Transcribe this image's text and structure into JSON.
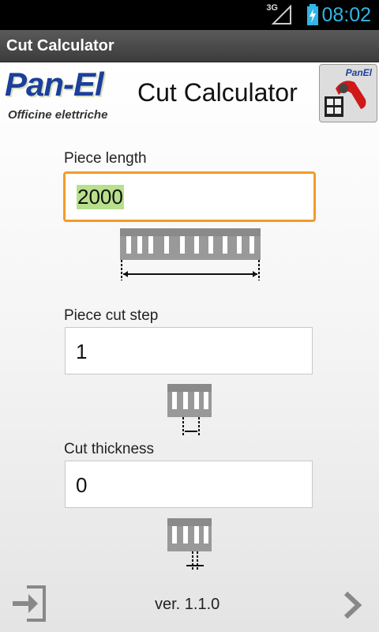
{
  "status_bar": {
    "network": "3G",
    "time": "08:02"
  },
  "app_title": "Cut Calculator",
  "header": {
    "logo_main": "Pan-El",
    "logo_sub": "Officine elettriche",
    "title": "Cut Calculator",
    "app_icon_text": "PanEl"
  },
  "form": {
    "piece_length": {
      "label": "Piece length",
      "value": "2000"
    },
    "piece_cut_step": {
      "label": "Piece cut step",
      "value": "1"
    },
    "cut_thickness": {
      "label": "Cut thickness",
      "value": "0"
    }
  },
  "footer": {
    "version": "ver. 1.1.0",
    "exit_icon": "exit-icon",
    "next_icon": "chevron-right-icon"
  },
  "colors": {
    "focus_border": "#f39b2a",
    "selection": "#b8e08c",
    "status_accent": "#33b5e5"
  }
}
